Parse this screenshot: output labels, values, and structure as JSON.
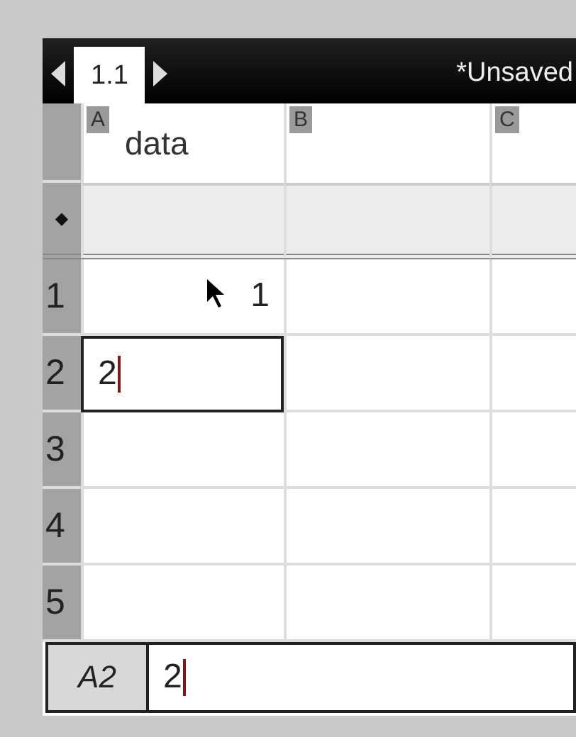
{
  "tab_bar": {
    "tabs": [
      {
        "label": "1.1",
        "selected": true
      }
    ],
    "title": "*Unsaved"
  },
  "columns": [
    {
      "letter": "A",
      "name": "data"
    },
    {
      "letter": "B"
    },
    {
      "letter": "C"
    }
  ],
  "formula_row": {
    "marker": "◆"
  },
  "rows": [
    {
      "number": "1",
      "cells": [
        {
          "value": "1",
          "selected": false
        },
        {
          "selected": false
        },
        {
          "selected": false
        }
      ]
    },
    {
      "number": "2",
      "cells": [
        {
          "value": "2",
          "selected": true
        },
        {
          "selected": false
        },
        {
          "selected": false
        }
      ]
    },
    {
      "number": "3",
      "cells": [
        {
          "selected": false
        },
        {
          "selected": false
        },
        {
          "selected": false
        }
      ]
    },
    {
      "number": "4",
      "cells": [
        {
          "selected": false
        },
        {
          "selected": false
        },
        {
          "selected": false
        }
      ]
    },
    {
      "number": "5",
      "cells": [
        {
          "selected": false
        },
        {
          "selected": false
        },
        {
          "selected": false
        }
      ]
    }
  ],
  "entry_line": {
    "cell_ref": "A2",
    "value": "2"
  }
}
